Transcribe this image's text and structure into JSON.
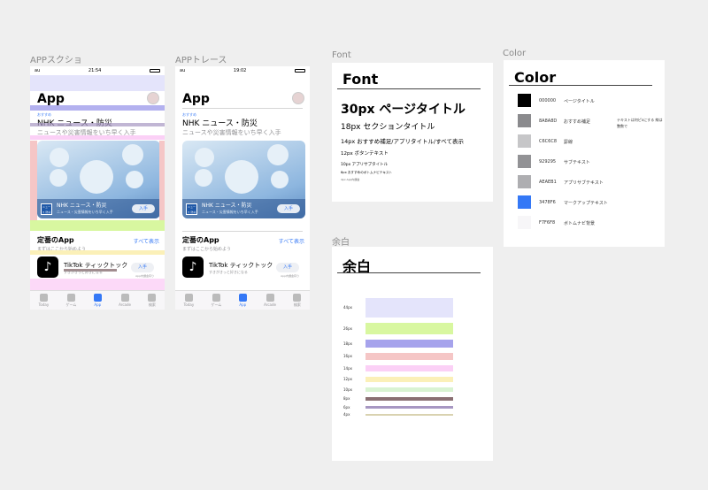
{
  "frames": {
    "capture": "APPスクショ",
    "trace": "APPトレース",
    "font": "Font",
    "color": "Color",
    "spacing": "余白"
  },
  "phone_capture": {
    "carrier": "au",
    "time": "21:54",
    "title": "App",
    "recommend": "おすすめ",
    "card_title": "NHK ニュース・防災",
    "card_sub": "ニュースや災害情報をいち早く入手",
    "banner_icon_text": "ニュース 防災",
    "banner_app": "NHK ニュース・防災",
    "banner_sub": "ニュース・災害情報をいち早く入手",
    "banner_get": "入手",
    "section": "定番のApp",
    "see_all": "すべて表示",
    "section_sub": "まずはここから始めよう",
    "app_name": "TikTok ティックトック",
    "app_sub": "すきがきっと好きになる",
    "app_get": "入手",
    "app_note": "App内課金有り",
    "tabs": [
      "Today",
      "ゲーム",
      "App",
      "Arcade",
      "検索"
    ]
  },
  "phone_trace": {
    "carrier": "au",
    "time": "19:02",
    "title": "App",
    "recommend": "おすすめ",
    "card_title": "NHK ニュース・防災",
    "card_sub": "ニュースや災害情報をいち早く入手",
    "banner_icon_text": "ニュース 防災",
    "banner_app": "NHK ニュース・防災",
    "banner_sub": "ニュース・災害情報をいち早く入手",
    "banner_get": "入手",
    "section": "定番のApp",
    "see_all": "すべて表示",
    "section_sub": "まずはここから始めよう",
    "app_name": "TikTok ティックトック",
    "app_sub": "すきがきっと好きになる",
    "app_get": "入手",
    "app_note": "App内課金有り",
    "tabs": [
      "Today",
      "ゲーム",
      "App",
      "Arcade",
      "検索"
    ]
  },
  "font_card": {
    "title": "Font",
    "rows": [
      "30px ページタイトル",
      "18px セクションタイトル",
      "14px おすすめ補足/アプリタイトル/すべて表示",
      "12px ボタンテキスト",
      "10px アプリサブタイトル",
      "8px おすすめのボトムナビテキスト",
      "4px App内課金"
    ]
  },
  "color_card": {
    "title": "Color",
    "note": "テキストは何ピxにする 線は整数で",
    "swatches": [
      {
        "hex": "000000",
        "label": "ページタイトル",
        "color": "#000000"
      },
      {
        "hex": "8A8A8D",
        "label": "おすすめ補足",
        "color": "#8A8A8D"
      },
      {
        "hex": "C6C6C8",
        "label": "罫線",
        "color": "#C6C6C8"
      },
      {
        "hex": "929295",
        "label": "サブテキスト",
        "color": "#929295"
      },
      {
        "hex": "AEAEB1",
        "label": "アプリサブテキスト",
        "color": "#AEAEB1"
      },
      {
        "hex": "3478F6",
        "label": "マークアップテキスト",
        "color": "#3478F6"
      },
      {
        "hex": "F7F6F8",
        "label": "ボトムナビ背景",
        "color": "#F7F6F8"
      }
    ]
  },
  "spacing_card": {
    "title": "余白",
    "rows": [
      {
        "label": "44px",
        "color": "#e4e4fb"
      },
      {
        "label": "26px",
        "color": "#d8f7a0"
      },
      {
        "label": "18px",
        "color": "#a6a3ec"
      },
      {
        "label": "16px",
        "color": "#f5c6c6"
      },
      {
        "label": "14px",
        "color": "#fbd0f6"
      },
      {
        "label": "12px",
        "color": "#fbf0b8"
      },
      {
        "label": "10px",
        "color": "#d9f3d2"
      },
      {
        "label": "8px",
        "color": "#8a6f73"
      },
      {
        "label": "6px",
        "color": "#a797c2"
      },
      {
        "label": "4px",
        "color": "#d9d2b0"
      }
    ]
  }
}
